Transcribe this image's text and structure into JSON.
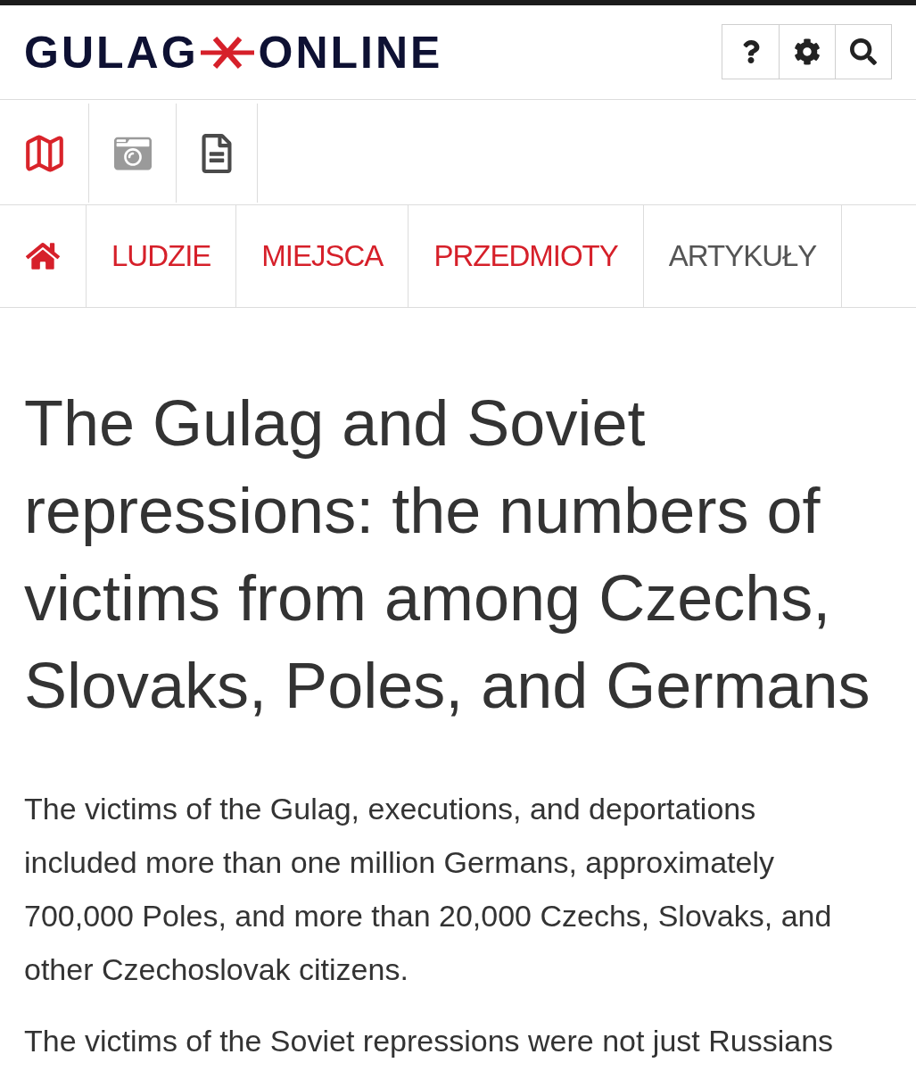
{
  "header": {
    "logo": {
      "left": "GULAG",
      "right": "ONLINE"
    },
    "buttons": [
      {
        "kind": "help"
      },
      {
        "kind": "settings"
      },
      {
        "kind": "search"
      }
    ]
  },
  "media_tabs": [
    {
      "kind": "map",
      "color": "#d9232a"
    },
    {
      "kind": "photo",
      "color": "#9a9a9a"
    },
    {
      "kind": "document",
      "color": "#4a4a4a"
    }
  ],
  "nav": [
    {
      "kind": "home",
      "selected": false
    },
    {
      "kind": "link",
      "label": "LUDZIE",
      "selected": false
    },
    {
      "kind": "link",
      "label": "MIEJSCA",
      "selected": false
    },
    {
      "kind": "link",
      "label": "PRZEDMIOTY",
      "selected": false
    },
    {
      "kind": "link",
      "label": "ARTYKUŁY",
      "selected": true
    }
  ],
  "article": {
    "title": "The Gulag and Soviet repressions: the numbers of victims from among Czechs, Slovaks, Poles, and Germans",
    "paragraphs": [
      "The victims of the Gulag, executions, and deportations included more than one million Germans, approximately 700,000 Poles, and more than 20,000 Czechs, Slovaks, and other Czechoslovak citizens.",
      "The victims of the Soviet repressions were not just Russians"
    ]
  }
}
